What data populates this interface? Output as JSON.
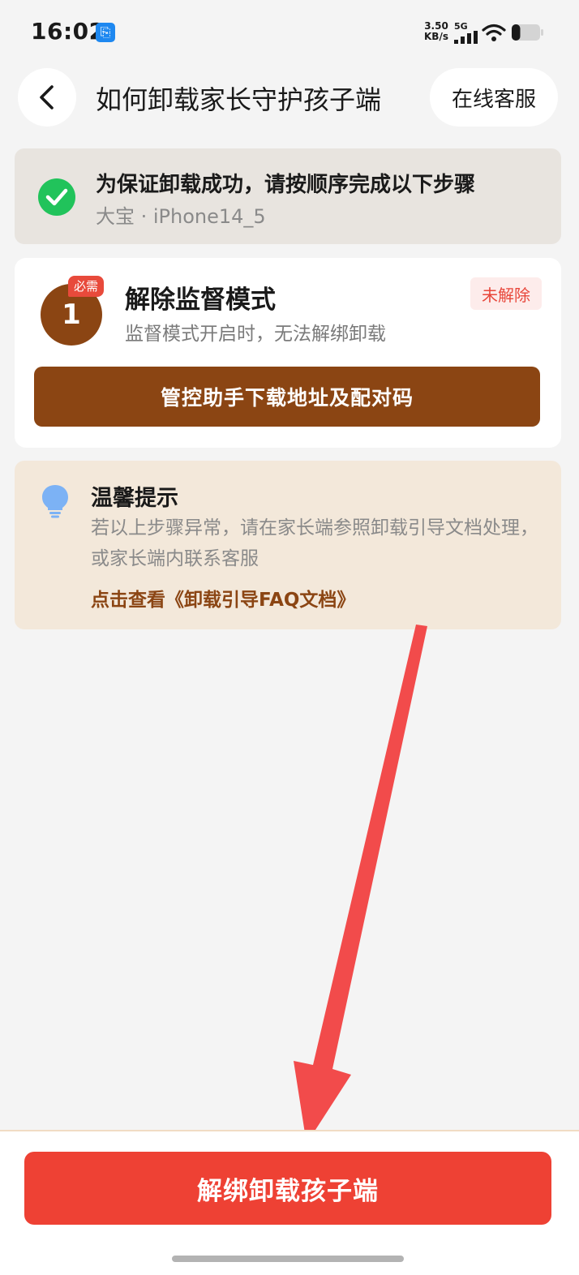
{
  "status_bar": {
    "time": "16:02",
    "usb_icon": "usb-icon",
    "net_speed_value": "3.50",
    "net_speed_unit": "KB/s",
    "network_type": "5G",
    "battery_level": 0.3
  },
  "header": {
    "back_icon": "chevron-left-icon",
    "title": "如何卸载家长守护孩子端",
    "service_label": "在线客服"
  },
  "notice": {
    "icon": "check-circle-icon",
    "title": "为保证卸载成功，请按顺序完成以下步骤",
    "device": "大宝 · iPhone14_5",
    "colors": {
      "check": "#21c35b"
    }
  },
  "step": {
    "number": "1",
    "required_tag": "必需",
    "title": "解除监督模式",
    "description": "监督模式开启时，无法解绑卸载",
    "status": "未解除",
    "action_label": "管控助手下载地址及配对码",
    "colors": {
      "primary": "#8b4513",
      "status_text": "#e8473b",
      "status_bg": "#fdeceb"
    }
  },
  "tip": {
    "icon": "lightbulb-icon",
    "title": "温馨提示",
    "body": "若以上步骤异常，请在家长端参照卸载引导文档处理，或家长端内联系客服",
    "link": "点击查看《卸载引导FAQ文档》"
  },
  "bottom": {
    "unbind_label": "解绑卸载孩子端",
    "colors": {
      "unbind": "#ee4134"
    }
  },
  "annotation": {
    "arrow_icon": "arrow-annotation-icon",
    "color": "#f24b4b"
  }
}
